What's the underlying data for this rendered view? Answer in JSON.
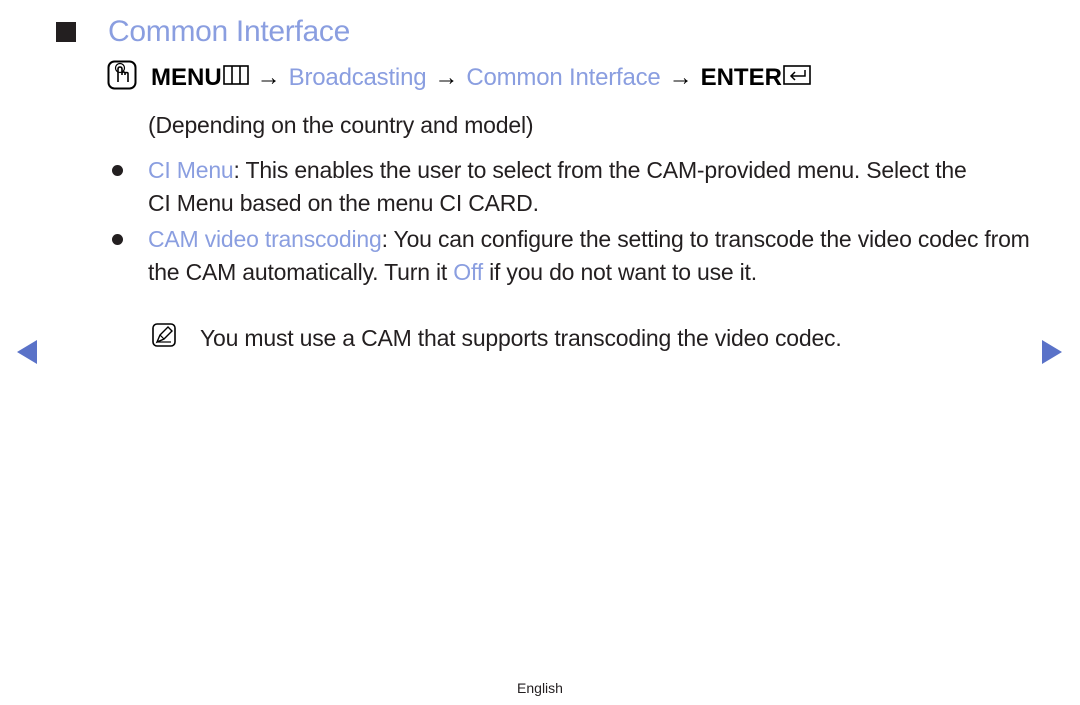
{
  "title": {
    "square_icon": "black-square-icon",
    "text": "Common Interface"
  },
  "menu_path": {
    "hand_icon": "hand-pointer-icon",
    "menu_label": "MENU",
    "menu_icon": "menu-grid-icon",
    "arrow": "→",
    "items": [
      "Broadcasting",
      "Common Interface"
    ],
    "enter_label": "ENTER",
    "enter_icon": "enter-return-icon"
  },
  "intro": "(Depending on the country and model)",
  "bullets": [
    {
      "term": "CI Menu",
      "text": ": This enables the user to select from the CAM-provided menu. Select the CI Menu based on the menu CI CARD."
    },
    {
      "term": "CAM video transcoding",
      "text_before": ": You can configure the setting to transcode the video codec from the CAM automatically. Turn it ",
      "highlight": "Off",
      "text_after": " if you do not want to use it."
    }
  ],
  "note": {
    "icon": "note-pencil-icon",
    "text": "You must use a CAM that supports transcoding the video codec."
  },
  "navigation": {
    "prev_icon": "previous-page-arrow-icon",
    "next_icon": "next-page-arrow-icon"
  },
  "footer": {
    "language": "English"
  },
  "colors": {
    "accent": "#8a9ee0",
    "nav_arrow": "#5a72c8",
    "text": "#231f20"
  }
}
